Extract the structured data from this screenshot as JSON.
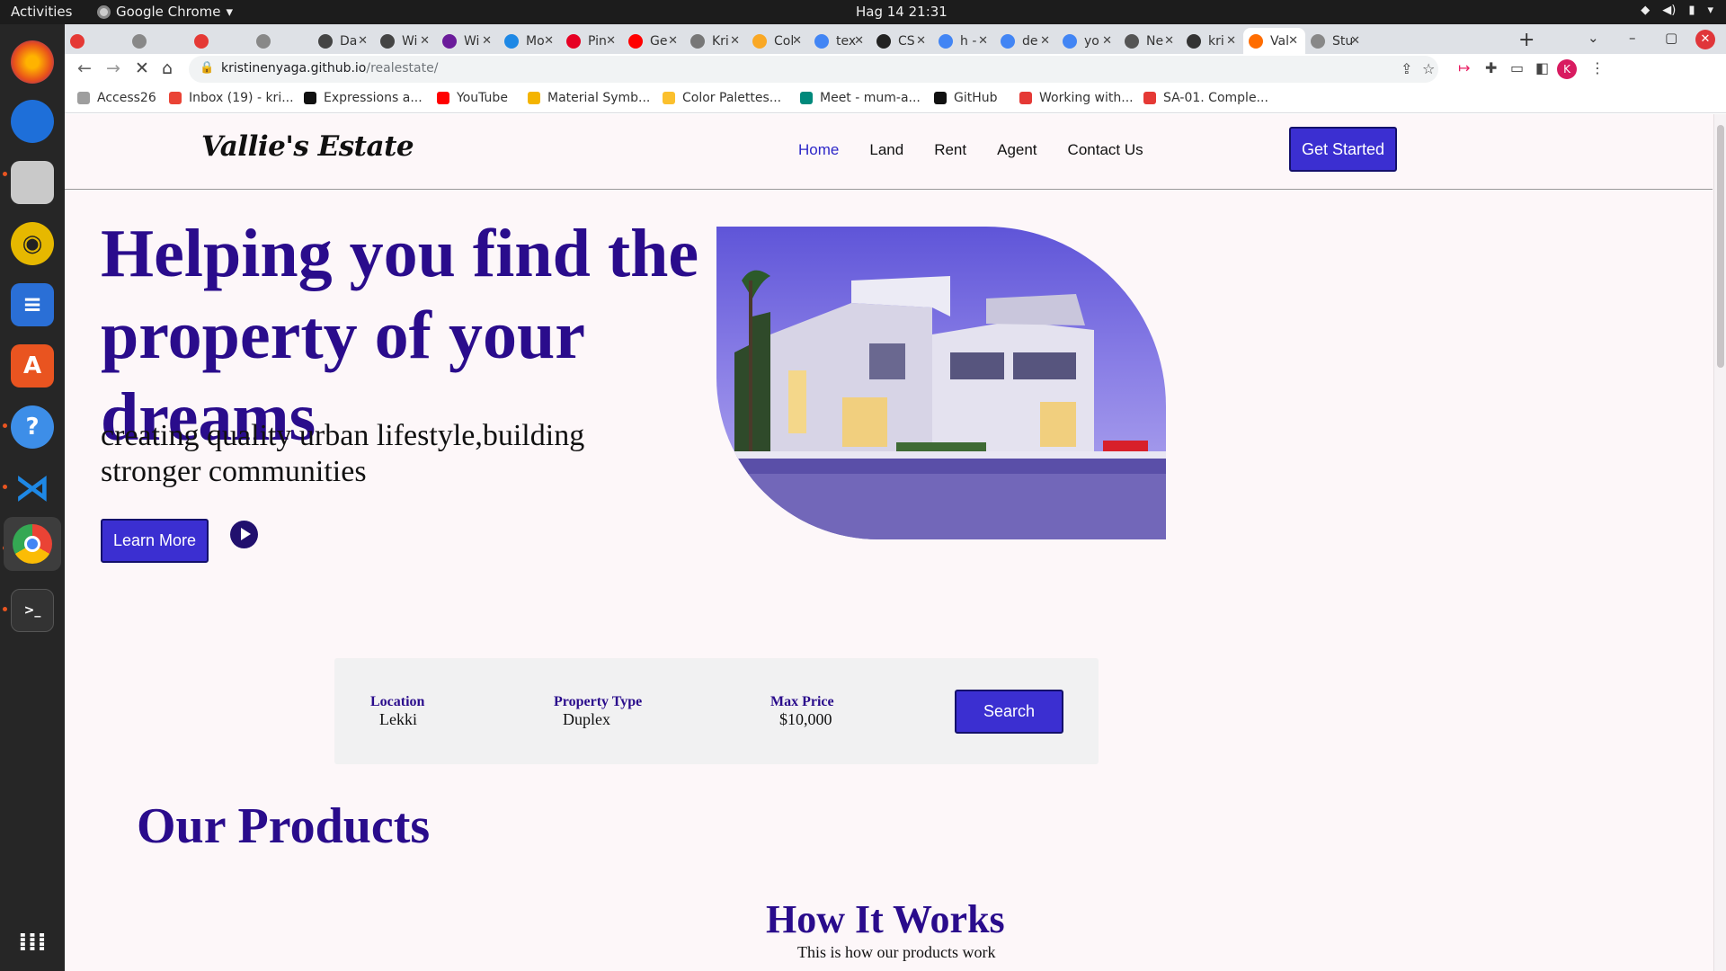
{
  "os": {
    "activities": "Activities",
    "app_name": "Google Chrome",
    "clock": "Hag 14  21:31"
  },
  "browser": {
    "tabs": [
      {
        "label": "",
        "color": "#e53935"
      },
      {
        "label": "",
        "color": "#888888"
      },
      {
        "label": "",
        "color": "#e53935"
      },
      {
        "label": "",
        "color": "#888888"
      },
      {
        "label": "Da",
        "color": "#444444"
      },
      {
        "label": "Wi",
        "color": "#444444"
      },
      {
        "label": "Wi",
        "color": "#6a1b9a"
      },
      {
        "label": "Mo",
        "color": "#1e88e5"
      },
      {
        "label": "Pin",
        "color": "#e60023"
      },
      {
        "label": "Ge",
        "color": "#ff0000"
      },
      {
        "label": "Kri",
        "color": "#777777"
      },
      {
        "label": "Col",
        "color": "#f9a825"
      },
      {
        "label": "tex",
        "color": "#4285f4"
      },
      {
        "label": "CS",
        "color": "#222222"
      },
      {
        "label": "h -",
        "color": "#4285f4"
      },
      {
        "label": "de",
        "color": "#4285f4"
      },
      {
        "label": "yo",
        "color": "#4285f4"
      },
      {
        "label": "Ne",
        "color": "#555555"
      },
      {
        "label": "kri",
        "color": "#333333"
      },
      {
        "label": "Val",
        "color": "#ff6d00"
      },
      {
        "label": "Stu",
        "color": "#888888"
      }
    ],
    "active_tab_index": 19,
    "url_host": "kristinenyaga.github.io",
    "url_path": "/realestate/",
    "profile_initial": "K",
    "bookmarks": [
      {
        "label": "Access26",
        "color": "#9e9e9e"
      },
      {
        "label": "Inbox (19) - kri...",
        "color": "#ea4335"
      },
      {
        "label": "Expressions a...",
        "color": "#111111"
      },
      {
        "label": "YouTube",
        "color": "#ff0000"
      },
      {
        "label": "Material Symb...",
        "color": "#f4b400"
      },
      {
        "label": "Color Palettes...",
        "color": "#fbc02d"
      },
      {
        "label": "Meet - mum-a...",
        "color": "#00897b"
      },
      {
        "label": "GitHub",
        "color": "#111111"
      },
      {
        "label": "Working with...",
        "color": "#e53935"
      },
      {
        "label": "SA-01. Comple...",
        "color": "#e53935"
      }
    ]
  },
  "site": {
    "logo": "Vallie's Estate",
    "nav": [
      "Home",
      "Land",
      "Rent",
      "Agent",
      "Contact Us"
    ],
    "cta": "Get Started",
    "hero_title": "Helping you find the property of your dreams",
    "hero_subtitle": "creating quality urban lifestyle,building stronger communities",
    "learn_more": "Learn More",
    "search": {
      "location_label": "Location",
      "location_value": "Lekki",
      "type_label": "Property Type",
      "type_value": "Duplex",
      "price_label": "Max Price",
      "price_value": "$10,000",
      "button": "Search"
    },
    "products_title": "Our Products",
    "how_title": "How It Works",
    "how_subtitle": "This is how our products work"
  },
  "colors": {
    "accent": "#3b2fd1",
    "heading": "#2a0c8c",
    "nav_active": "#2d27c8",
    "page_bg": "#fdf7f9"
  }
}
